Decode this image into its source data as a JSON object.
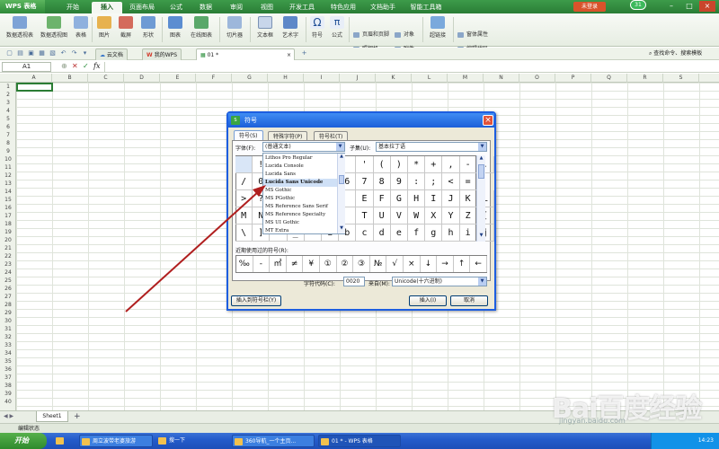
{
  "app": {
    "name": "WPS 表格"
  },
  "menubar": {
    "tabs": [
      "开始",
      "插入",
      "页面布局",
      "公式",
      "数据",
      "审阅",
      "视图",
      "开发工具",
      "特色应用",
      "文档助手",
      "智能工具箱"
    ],
    "login": "未登录",
    "badge": "31"
  },
  "ribbon": {
    "pivot_table": "数据透视表",
    "pivot_chart": "数据透视图",
    "table": "表格",
    "picture": "图片",
    "screenshot": "截屏",
    "shape": "形状",
    "chart": "图表",
    "online_chart": "在线图表",
    "slicer": "切片器",
    "text_box": "文本框",
    "art_word": "艺术字",
    "symbol": "符号",
    "formula": "公式",
    "header_footer": "页眉和页脚",
    "object": "对象",
    "camera": "照相机",
    "attachment": "附件",
    "hyperlink": "超链接",
    "form_props": "窗体属性",
    "edit_code": "编辑代码"
  },
  "quickbar": {
    "cloud": "云文档",
    "mywps": "我的WPS",
    "doc": "01 *",
    "search": "查找命令、搜索模板"
  },
  "formulabar": {
    "cell": "A1",
    "fx": "fx"
  },
  "grid": {
    "columns": [
      "A",
      "B",
      "C",
      "D",
      "E",
      "F",
      "G",
      "H",
      "I",
      "J",
      "K",
      "L",
      "M",
      "N",
      "O",
      "P",
      "Q",
      "R",
      "S"
    ],
    "rows": [
      "1",
      "2",
      "3",
      "4",
      "5",
      "6",
      "7",
      "8",
      "9",
      "10",
      "11",
      "12",
      "13",
      "14",
      "15",
      "16",
      "17",
      "18",
      "19",
      "20",
      "21",
      "22",
      "23",
      "24",
      "25",
      "26",
      "27",
      "28",
      "29",
      "30",
      "31",
      "32",
      "33",
      "34",
      "35",
      "36",
      "37",
      "38",
      "39",
      "40"
    ]
  },
  "sheets": {
    "tab": "Sheet1",
    "add": "+"
  },
  "status": {
    "text": "编辑状态"
  },
  "taskbar": {
    "start": "开始",
    "items": [
      "周立波带老婆旅游",
      "搜一下",
      "360导航_一个主页...",
      "01 * - WPS 表格"
    ],
    "clock": "14:23"
  },
  "dialog": {
    "title": "符号",
    "tabs": [
      "符号(S)",
      "特殊字符(P)",
      "符号栏(T)"
    ],
    "font_label": "字体(F):",
    "font_value": "(普通文本)",
    "subset_label": "子集(U):",
    "subset_value": "基本拉丁语",
    "fonts": [
      "Lithos Pro Regular",
      "Lucida Console",
      "Lucida Sans",
      "Lucida Sans Unicode",
      "MS Gothic",
      "MS PGothic",
      "MS Reference Sans Serif",
      "MS Reference Specialty",
      "MS UI Gothic",
      "MT Extra"
    ],
    "symbols_row1": [
      "",
      "!",
      "",
      "",
      "",
      "",
      "",
      "'",
      "(",
      ")",
      "*",
      "+",
      ",",
      "-",
      "."
    ],
    "symbols_row2": [
      "/",
      "0",
      "",
      "",
      "",
      "",
      "6",
      "7",
      "8",
      "9",
      ":",
      ";",
      "<",
      "="
    ],
    "symbols_row3": [
      ">",
      "?",
      "",
      "",
      "",
      "",
      "",
      "E",
      "F",
      "G",
      "H",
      "I",
      "J",
      "K",
      "L"
    ],
    "symbols_row4": [
      "M",
      "N",
      "",
      "",
      "",
      "",
      "",
      "T",
      "U",
      "V",
      "W",
      "X",
      "Y",
      "Z",
      "["
    ],
    "symbols_row5": [
      "\\",
      "]",
      "",
      "_",
      "",
      "a",
      "b",
      "c",
      "d",
      "e",
      "f",
      "g",
      "h",
      "i",
      "j"
    ],
    "recent_label": "近期使用过的符号(R):",
    "recent": [
      "‰",
      "-",
      "㎡",
      "≠",
      "¥",
      "①",
      "②",
      "③",
      "№",
      "√",
      "×",
      "↓",
      "→",
      "↑",
      "←"
    ],
    "code_label": "字符代码(C):",
    "code_value": "0020",
    "from_label": "来自(M):",
    "from_value": "Unicode(十六进制)",
    "insert_to_bar": "插入到符号栏(Y)",
    "insert": "插入(I)",
    "cancel": "取消"
  },
  "watermark": {
    "brand": "Bai百度经验",
    "url": "jingyan.baidu.com"
  },
  "colors": {
    "wps_green": "#2a7d36",
    "dialog_blue": "#1d5ee0",
    "arrow": "#b01f1f"
  }
}
